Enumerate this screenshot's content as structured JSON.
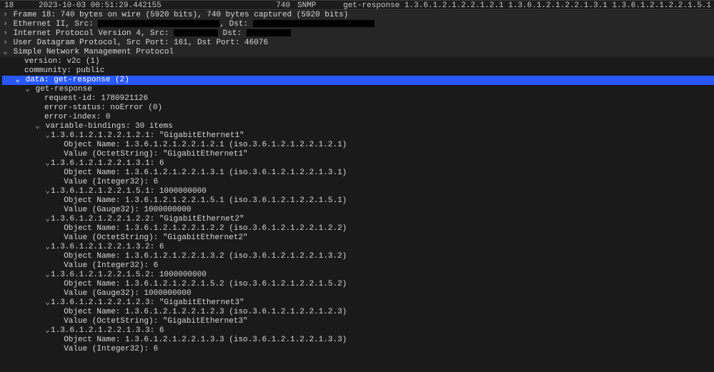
{
  "packet_list": {
    "no": "18",
    "time": "2023-10-03 00:51:29.442155",
    "len": "740",
    "proto": "SNMP",
    "info": "get-response 1.3.6.1.2.1.2.2.1.2.1 1.3.6.1.2.1.2.2.1.3.1 1.3.6.1.2.1.2.2.1.5.1"
  },
  "frame_line": "Frame 18: 740 bytes on wire (5920 bits), 740 bytes captured (5920 bits)",
  "eth_prefix": "Ethernet II, Src: ",
  "eth_dst_label": ", Dst: ",
  "ip_prefix": "Internet Protocol Version 4, Src: ",
  "ip_dst_label": "Dst: ",
  "udp_line": "User Datagram Protocol, Src Port: 161, Dst Port: 46076",
  "snmp_header": "Simple Network Management Protocol",
  "snmp": {
    "version": "version: v2c (1)",
    "community": "community: public",
    "data_hdr": "data: get-response (2)",
    "gr_label": "get-response",
    "req_id": "request-id: 1780921126",
    "err_status": "error-status: noError (0)",
    "err_index": "error-index: 0",
    "vb_header": "variable-bindings: 30 items"
  },
  "vbs": [
    {
      "head": "1.3.6.1.2.1.2.2.1.2.1: \"GigabitEthernet1\"",
      "name": "Object Name: 1.3.6.1.2.1.2.2.1.2.1 (iso.3.6.1.2.1.2.2.1.2.1)",
      "val": "Value (OctetString): \"GigabitEthernet1\""
    },
    {
      "head": "1.3.6.1.2.1.2.2.1.3.1: 6",
      "name": "Object Name: 1.3.6.1.2.1.2.2.1.3.1 (iso.3.6.1.2.1.2.2.1.3.1)",
      "val": "Value (Integer32): 6"
    },
    {
      "head": "1.3.6.1.2.1.2.2.1.5.1: 1000000000",
      "name": "Object Name: 1.3.6.1.2.1.2.2.1.5.1 (iso.3.6.1.2.1.2.2.1.5.1)",
      "val": "Value (Gauge32): 1000000000"
    },
    {
      "head": "1.3.6.1.2.1.2.2.1.2.2: \"GigabitEthernet2\"",
      "name": "Object Name: 1.3.6.1.2.1.2.2.1.2.2 (iso.3.6.1.2.1.2.2.1.2.2)",
      "val": "Value (OctetString): \"GigabitEthernet2\""
    },
    {
      "head": "1.3.6.1.2.1.2.2.1.3.2: 6",
      "name": "Object Name: 1.3.6.1.2.1.2.2.1.3.2 (iso.3.6.1.2.1.2.2.1.3.2)",
      "val": "Value (Integer32): 6"
    },
    {
      "head": "1.3.6.1.2.1.2.2.1.5.2: 1000000000",
      "name": "Object Name: 1.3.6.1.2.1.2.2.1.5.2 (iso.3.6.1.2.1.2.2.1.5.2)",
      "val": "Value (Gauge32): 1000000000"
    },
    {
      "head": "1.3.6.1.2.1.2.2.1.2.3: \"GigabitEthernet3\"",
      "name": "Object Name: 1.3.6.1.2.1.2.2.1.2.3 (iso.3.6.1.2.1.2.2.1.2.3)",
      "val": "Value (OctetString): \"GigabitEthernet3\""
    },
    {
      "head": "1.3.6.1.2.1.2.2.1.3.3: 6",
      "name": "Object Name: 1.3.6.1.2.1.2.2.1.3.3 (iso.3.6.1.2.1.2.2.1.3.3)",
      "val": "Value (Integer32): 6"
    }
  ]
}
